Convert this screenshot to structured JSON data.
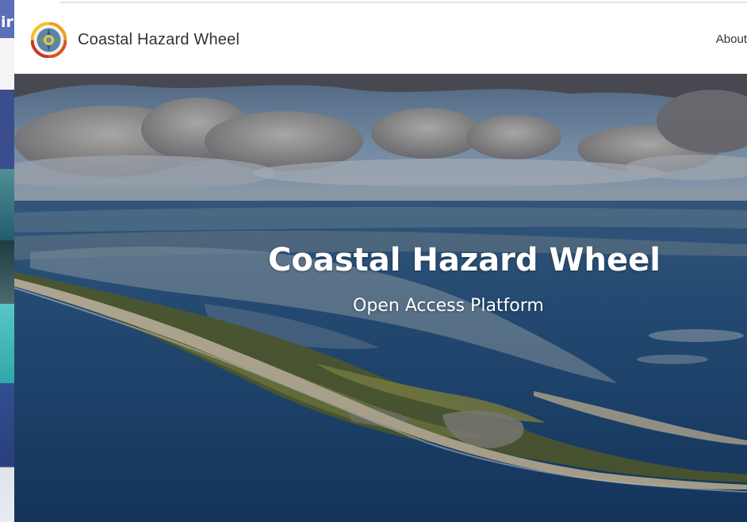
{
  "background_window": {
    "visible_fragment": "ir"
  },
  "header": {
    "logo_icon": "coastal-hazard-wheel-logo",
    "title": "Coastal Hazard Wheel",
    "nav": [
      {
        "label": "About"
      }
    ]
  },
  "hero": {
    "title": "Coastal Hazard Wheel",
    "subtitle": "Open Access Platform",
    "image": "aerial-coastal-island-photo"
  },
  "colors": {
    "text": "#333333",
    "hero_text": "#ffffff",
    "sea": "#1f4f86",
    "sky": "#6f8fb3"
  }
}
